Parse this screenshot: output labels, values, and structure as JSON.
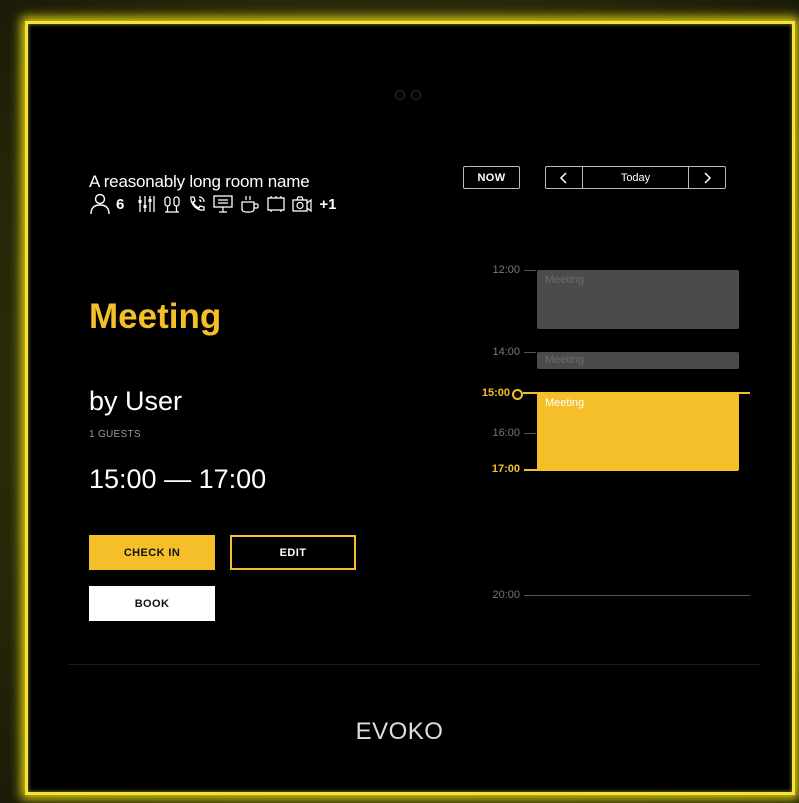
{
  "room": {
    "name": "A reasonably long room name",
    "capacity": "6",
    "more_amenities": "+1",
    "amenities": [
      "lights-icon",
      "microphone-icon",
      "phone-icon",
      "screen-icon",
      "coffee-icon",
      "whiteboard-icon",
      "camera-icon"
    ]
  },
  "meeting": {
    "title": "Meeting",
    "organizer": "by User",
    "guests": "1 GUESTS",
    "time_range": "15:00 — 17:00"
  },
  "actions": {
    "check_in": "CHECK IN",
    "edit": "EDIT",
    "book": "BOOK"
  },
  "calendar": {
    "now_label": "NOW",
    "date_label": "Today",
    "times": {
      "t1200": "12:00",
      "t1400": "14:00",
      "t1500": "15:00",
      "t1600": "16:00",
      "t1700": "17:00",
      "t2000": "20:00"
    },
    "events": {
      "e1": "Meeting",
      "e2": "Meeting",
      "e3": "Meeting"
    }
  },
  "footer": {
    "brand": "EVOKO"
  },
  "colors": {
    "accent": "#f5bf2a",
    "frame_glow": "#f5e23a",
    "background": "#000000",
    "event_grey": "#4b4b4b"
  }
}
